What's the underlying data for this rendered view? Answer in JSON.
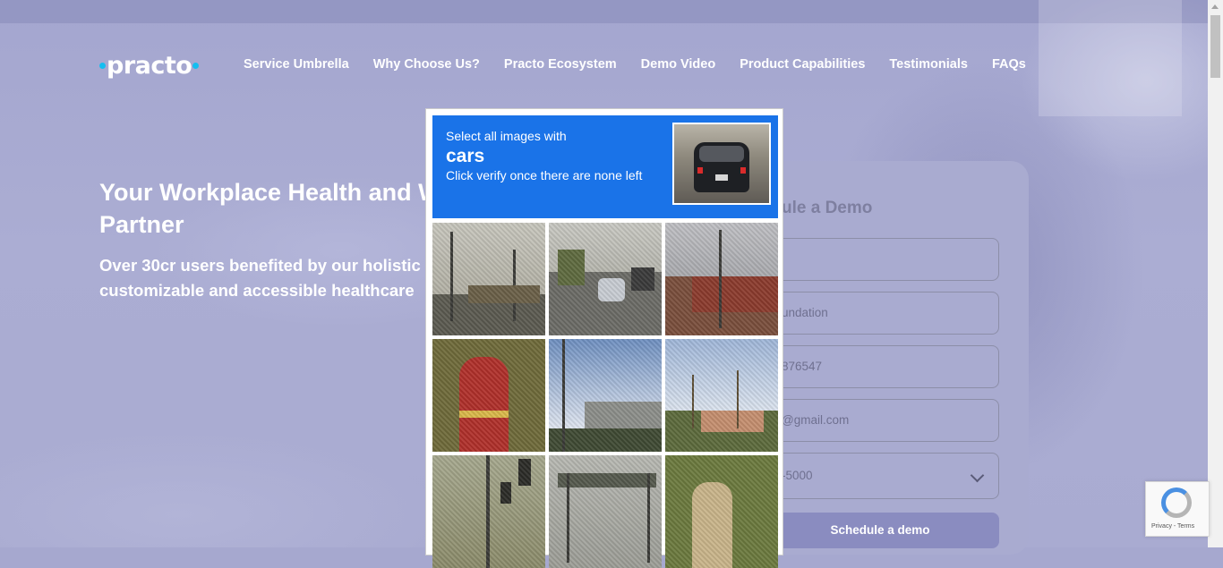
{
  "brand": {
    "logo_text": "practo",
    "accent": "#14bef0"
  },
  "nav": {
    "items": [
      "Service Umbrella",
      "Why Choose Us?",
      "Practo Ecosystem",
      "Demo Video",
      "Product Capabilities",
      "Testimonials",
      "FAQs"
    ]
  },
  "hero": {
    "title_line1": "Your Workplace Health and W",
    "title_line2": "Partner",
    "sub_line1": "Over 30cr users benefited by our holistic",
    "sub_line2": "customizable and accessible healthcare"
  },
  "form": {
    "title": "ule a Demo",
    "fields": [
      {
        "value": ""
      },
      {
        "value": "undation"
      },
      {
        "value": "876547"
      },
      {
        "value": "@gmail.com"
      },
      {
        "value": "-5000"
      }
    ],
    "submit_label": "Schedule a demo"
  },
  "captcha": {
    "instruction": "Select all images with",
    "target": "cars",
    "hint": "Click verify once there are none left",
    "header_color": "#1a73e8",
    "tiles": [
      "street-intersection",
      "street-with-cars",
      "brick-building-traffic-light",
      "fire-hydrant",
      "sky-building",
      "palm-trees",
      "traffic-light-pole",
      "highway-sign",
      "hydrant-bushes"
    ]
  },
  "recaptcha_badge": {
    "text": "Privacy - Terms"
  }
}
